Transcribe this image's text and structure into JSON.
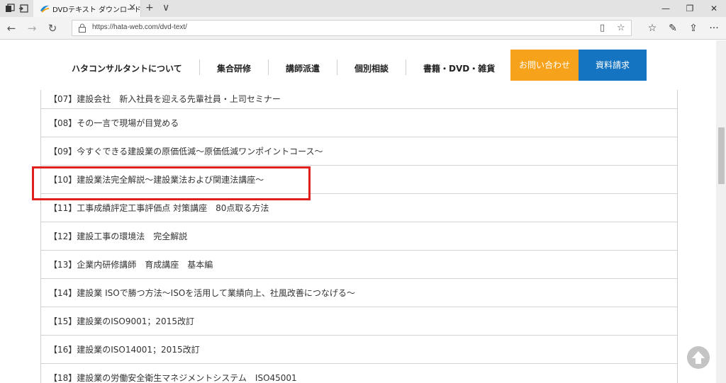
{
  "browser": {
    "tab_title": "DVDテキスト ダウンロード",
    "tab_close": "×",
    "new_tab": "+",
    "tab_menu": "∨",
    "window": {
      "minimize": "—",
      "restore": "❐",
      "close": "✕"
    },
    "nav": {
      "back": "←",
      "forward": "→",
      "refresh": "↻"
    },
    "url": "https://hata-web.com/dvd-text/",
    "address_icons": {
      "reading_view": "▯",
      "favorite": "☆"
    },
    "toolbar_icons": {
      "favorites": "☆",
      "notes": "✎",
      "share": "⇪",
      "more": "···"
    }
  },
  "header": {
    "menu": [
      "ハタコンサルタントについて",
      "集合研修",
      "講師派遣",
      "個別相談",
      "書籍・DVD・雑貨"
    ],
    "contact_button": "お問い合わせ",
    "request_button": "資料請求"
  },
  "list": {
    "items": [
      "【07】建設会社　新入社員を迎える先輩社員・上司セミナー",
      "【08】その一言で現場が目覚める",
      "【09】今すぐできる建設業の原価低減〜原価低減ワンポイントコース〜",
      "【10】建設業法完全解説〜建設業法および関連法講座〜",
      "【11】工事成績評定工事評価点 対策講座　80点取る方法",
      "【12】建設工事の環境法　完全解説",
      "【13】企業内研修講師　育成講座　基本編",
      "【14】建設業 ISOで勝つ方法〜ISOを活用して業績向上、社風改善につなげる〜",
      "【15】建設業のISO9001；2015改訂",
      "【16】建設業のISO14001；2015改訂",
      "【18】建設業の労働安全衛生マネジメントシステム　ISO45001"
    ]
  },
  "colors": {
    "contact": "#f7a21b",
    "request": "#1574c1",
    "highlight": "#e0201f"
  }
}
